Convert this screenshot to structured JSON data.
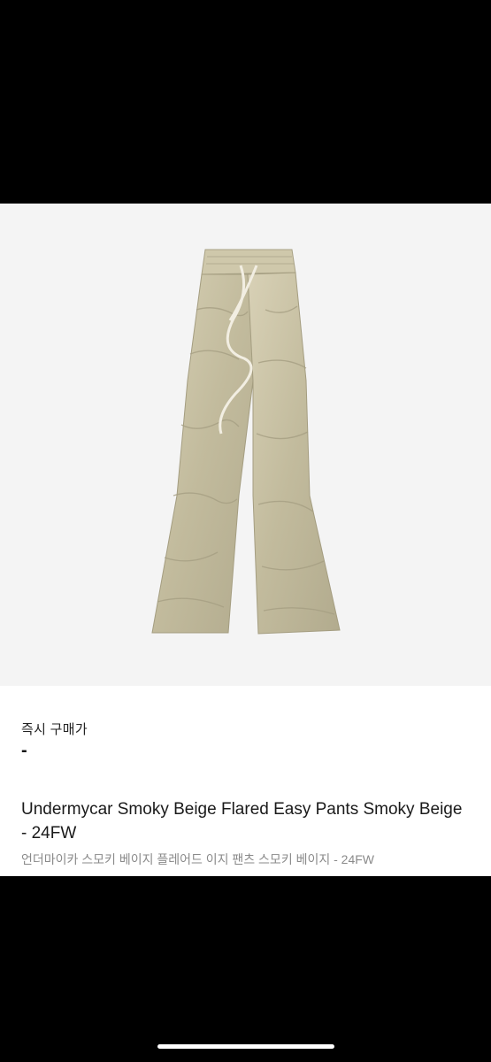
{
  "product": {
    "image_alt": "pants-photo",
    "price_label": "즉시 구매가",
    "price_value": "-",
    "title_en": "Undermycar Smoky Beige Flared Easy Pants Smoky Beige - 24FW",
    "title_ko": "언더마이카 스모키 베이지 플레어드 이지 팬츠 스모키 베이지 - 24FW"
  },
  "colors": {
    "image_background": "#f4f4f4",
    "pants_beige": "#c9c2a5",
    "secondary_text": "#8a8a8a"
  }
}
